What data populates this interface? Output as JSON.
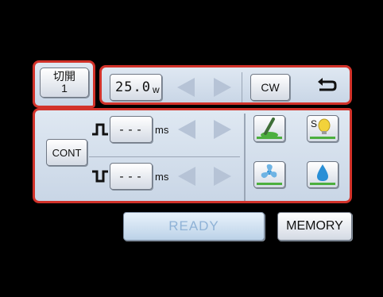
{
  "tab": {
    "line1": "切開",
    "line2": "1"
  },
  "power": {
    "value": "25.0",
    "unit": "w"
  },
  "mode_label": "CW",
  "cont_label": "CONT",
  "pulse_on": {
    "value": "---",
    "unit": "ms"
  },
  "pulse_off": {
    "value": "---",
    "unit": "ms"
  },
  "ready_label": "READY",
  "memory_label": "MEMORY",
  "colors": {
    "frame_red": "#d2322a",
    "panel_bg": "#dfe8f2",
    "icon_green": "#4caf3e",
    "icon_blue": "#2a8fd6",
    "ready_text": "#8fb2d6"
  },
  "icons": {
    "back": "return-arrow-icon",
    "mode1": "cutting-tool-icon",
    "mode2": "light-icon",
    "mode3": "fan-icon",
    "mode4": "water-drop-icon"
  }
}
